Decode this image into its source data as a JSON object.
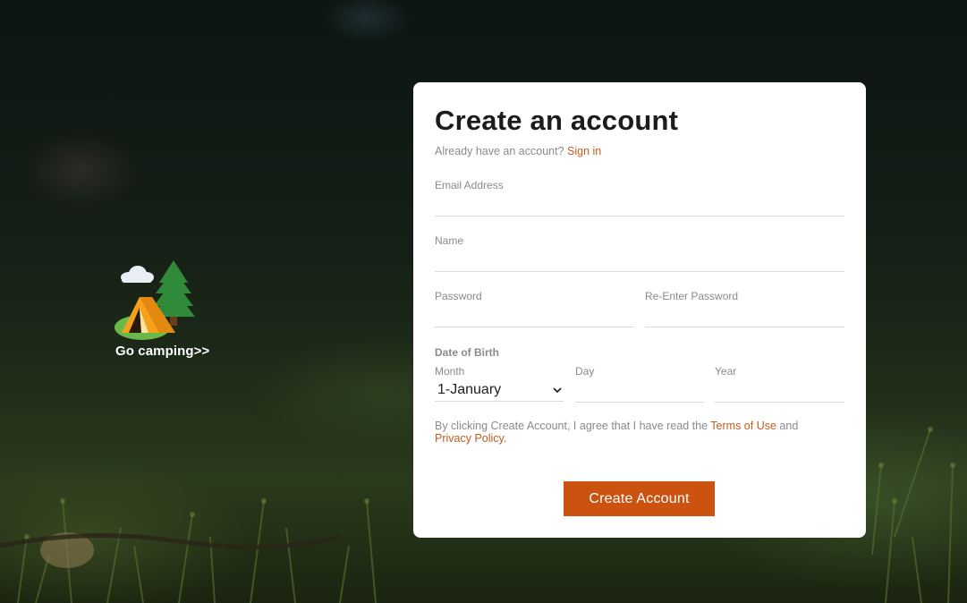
{
  "logo": {
    "caption": "Go camping>>",
    "icon": "tent-with-tree-and-cloud"
  },
  "form": {
    "title": "Create an account",
    "signin_prompt": "Already have an account?",
    "signin_link": "Sign in",
    "email_label": "Email Address",
    "email_value": "",
    "name_label": "Name",
    "name_value": "",
    "password_label": "Password",
    "password_value": "",
    "reenter_password_label": "Re-Enter Password",
    "reenter_password_value": "",
    "dob_heading": "Date of Birth",
    "month_label": "Month",
    "month_value": "1-January",
    "day_label": "Day",
    "day_value": "",
    "year_label": "Year",
    "year_value": "",
    "terms_prefix": "By clicking Create Account, I agree that I have read the",
    "terms_link": "Terms of Use",
    "terms_and": "and",
    "privacy_link": "Privacy Policy",
    "terms_suffix": ".",
    "submit_label": "Create Account"
  },
  "colors": {
    "accent": "#cc5210",
    "link": "#c85a1e",
    "card_background": "#ffffff",
    "label_gray": "#8a8a8a"
  }
}
